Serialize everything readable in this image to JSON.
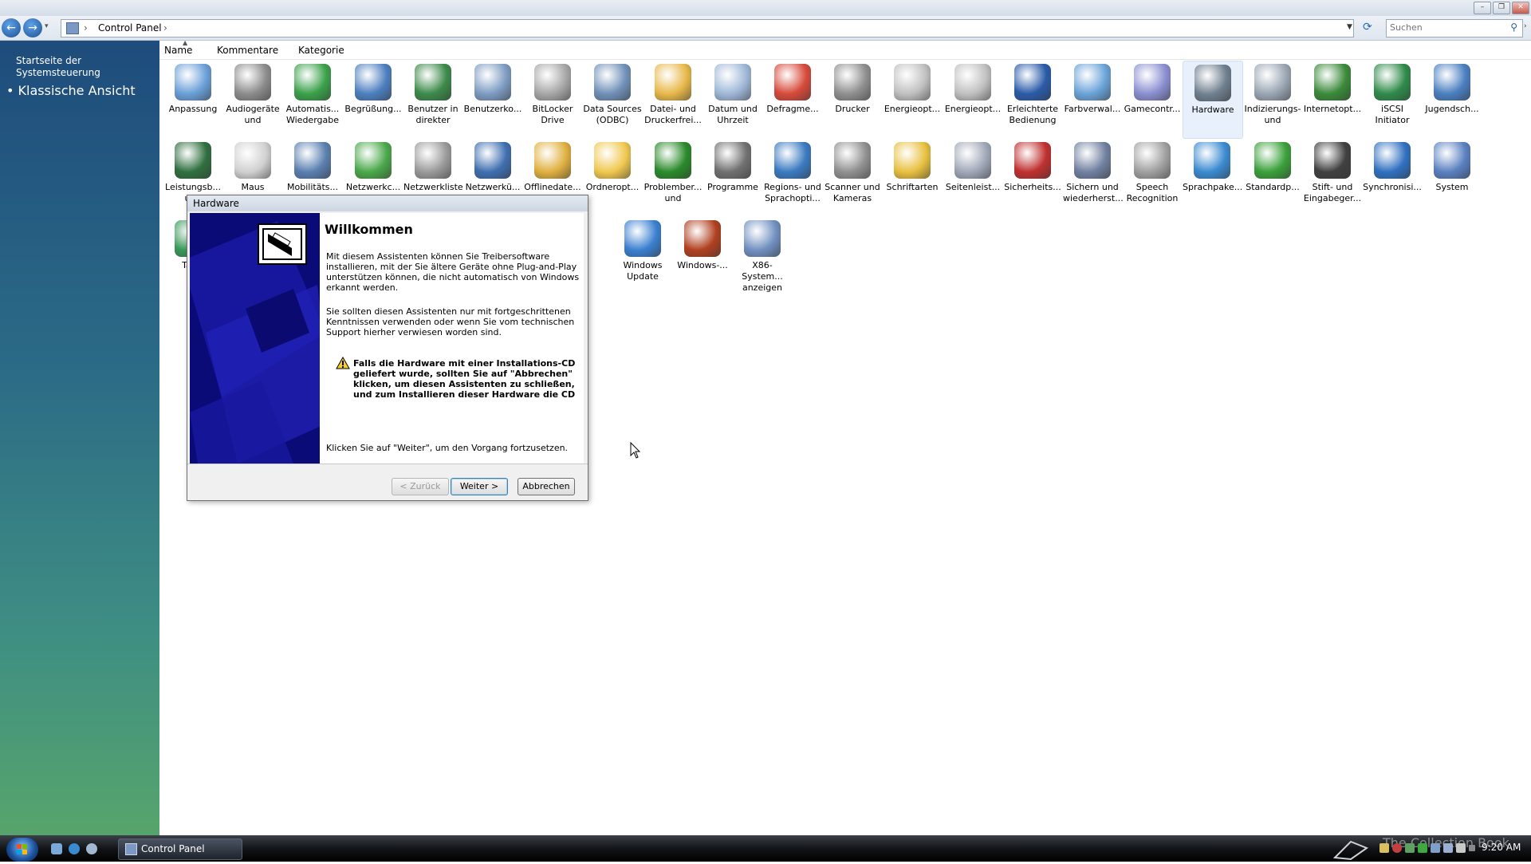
{
  "window": {
    "min_glyph": "–",
    "restore_glyph": "❐",
    "close_glyph": "✕"
  },
  "nav": {
    "back_glyph": "←",
    "forward_glyph": "→",
    "address": [
      "Control Panel"
    ],
    "search_placeholder": "Suchen"
  },
  "sidebar": {
    "home_label": "Startseite der Systemsteuerung",
    "classic_label": "Klassische Ansicht"
  },
  "columns": [
    "Name",
    "Kommentare",
    "Kategorie"
  ],
  "icons": {
    "row1": [
      {
        "label": "Anpassung",
        "icon": "personalization-icon",
        "color": "#6a9fd8"
      },
      {
        "label": "Audiogeräte und",
        "icon": "speaker-icon",
        "color": "#8c8c8c"
      },
      {
        "label": "Automatis... Wiedergabe",
        "icon": "autoplay-icon",
        "color": "#3aa14a"
      },
      {
        "label": "Begrüßung...",
        "icon": "welcome-center-icon",
        "color": "#4c7fbf"
      },
      {
        "label": "Benutzer in direkter",
        "icon": "people-near-me-icon",
        "color": "#3c8a4a"
      },
      {
        "label": "Benutzerko...",
        "icon": "user-accounts-icon",
        "color": "#7d9cc2"
      },
      {
        "label": "BitLocker Drive",
        "icon": "bitlocker-icon",
        "color": "#a7a7a7"
      },
      {
        "label": "Data Sources (ODBC)",
        "icon": "odbc-icon",
        "color": "#7090b8"
      },
      {
        "label": "Datei- und Druckerfrei...",
        "icon": "folder-share-icon",
        "color": "#e8b84a"
      },
      {
        "label": "Datum und Uhrzeit",
        "icon": "clock-icon",
        "color": "#9fb8d8"
      },
      {
        "label": "Defragme...",
        "icon": "defrag-icon",
        "color": "#d74a3a"
      },
      {
        "label": "Drucker",
        "icon": "printer-icon",
        "color": "#8f8f8f"
      },
      {
        "label": "Energieopt...",
        "icon": "power-options-icon",
        "color": "#c0c0c0"
      },
      {
        "label": "Energieopt...",
        "icon": "power-options-icon",
        "color": "#c0c0c0"
      },
      {
        "label": "Erleichterte Bedienung",
        "icon": "ease-of-access-icon",
        "color": "#2a5ba8"
      },
      {
        "label": "Farbverwal...",
        "icon": "color-management-icon",
        "color": "#6aa3d8"
      },
      {
        "label": "Gamecontr...",
        "icon": "gamepad-icon",
        "color": "#8a8fd0"
      },
      {
        "label": "Hardware",
        "icon": "hardware-icon",
        "color": "#6f7f8f"
      },
      {
        "label": "Indizierungs- und",
        "icon": "indexing-icon",
        "color": "#9aa6b3"
      },
      {
        "label": "Internetopt...",
        "icon": "internet-options-icon",
        "color": "#3a8a3a"
      },
      {
        "label": "iSCSI Initiator",
        "icon": "iscsi-icon",
        "color": "#2f8a4a"
      },
      {
        "label": "Jugendsch...",
        "icon": "parental-controls-icon",
        "color": "#4a7fc0"
      }
    ],
    "row2": [
      {
        "label": "Leistungsb... und",
        "icon": "performance-icon",
        "color": "#2f6f3f"
      },
      {
        "label": "Maus",
        "icon": "mouse-icon",
        "color": "#d0d0d0"
      },
      {
        "label": "Mobilitäts...",
        "icon": "mobility-center-icon",
        "color": "#5a7fb0"
      },
      {
        "label": "Netzwerkc...",
        "icon": "network-center-icon",
        "color": "#4aa84a"
      },
      {
        "label": "Netzwerkliste",
        "icon": "network-list-icon",
        "color": "#9a9a9a"
      },
      {
        "label": "Netzwerkü...",
        "icon": "network-map-icon",
        "color": "#3f6fb0"
      },
      {
        "label": "Offlinedate...",
        "icon": "offline-files-icon",
        "color": "#e0b040"
      },
      {
        "label": "Ordneropt...",
        "icon": "folder-options-icon",
        "color": "#f0c850"
      },
      {
        "label": "Problember... und",
        "icon": "problem-reports-icon",
        "color": "#2a8a2a"
      },
      {
        "label": "Programme",
        "icon": "programs-icon",
        "color": "#707070"
      },
      {
        "label": "Regions- und Sprachopti...",
        "icon": "regional-globe-icon",
        "color": "#3a7ac0"
      },
      {
        "label": "Scanner und Kameras",
        "icon": "camera-icon",
        "color": "#909090"
      },
      {
        "label": "Schriftarten",
        "icon": "fonts-folder-icon",
        "color": "#e8c040"
      },
      {
        "label": "Seitenleist...",
        "icon": "sidebar-gear-icon",
        "color": "#a0a8b8"
      },
      {
        "label": "Sicherheits...",
        "icon": "security-shield-icon",
        "color": "#c03030"
      },
      {
        "label": "Sichern und wiederherst...",
        "icon": "backup-icon",
        "color": "#7080a0"
      },
      {
        "label": "Speech Recognition",
        "icon": "microphone-icon",
        "color": "#a0a0a0"
      },
      {
        "label": "Sprachpake...",
        "icon": "language-pack-icon",
        "color": "#3a8ad0"
      },
      {
        "label": "Standardp...",
        "icon": "default-programs-icon",
        "color": "#3aa03a"
      },
      {
        "label": "Stift- und Eingabeger...",
        "icon": "pen-icon",
        "color": "#404040"
      },
      {
        "label": "Synchronisi...",
        "icon": "sync-icon",
        "color": "#3070c0"
      },
      {
        "label": "System",
        "icon": "system-icon",
        "color": "#5a80c0"
      }
    ],
    "row3": [
      {
        "label": "Tas...",
        "icon": "taskbar-icon",
        "color": "#3a9a5a"
      },
      {
        "label": "Windows Update",
        "icon": "windows-update-icon",
        "color": "#3a80d0"
      },
      {
        "label": "Windows-...",
        "icon": "firewall-icon",
        "color": "#b04020"
      },
      {
        "label": "X86-System... anzeigen",
        "icon": "x86-system-icon",
        "color": "#7090c0"
      }
    ]
  },
  "dialog": {
    "title": "Hardware",
    "heading": "Willkommen",
    "para1": [
      "Mit diesem Assistenten können Sie Treibersoftware",
      "installieren, mit der Sie ältere Geräte ohne Plug-and-Play",
      "unterstützen können, die nicht automatisch von Windows",
      "erkannt werden."
    ],
    "para2": [
      "Sie sollten diesen Assistenten nur mit fortgeschrittenen",
      "Kenntnissen verwenden oder wenn Sie vom technischen",
      "Support hierher verwiesen worden sind."
    ],
    "warning": [
      "Falls die Hardware mit einer Installations-CD",
      "geliefert wurde, sollten Sie auf \"Abbrechen\"",
      "klicken, um diesen Assistenten zu schließen,",
      "und zum Installieren dieser Hardware die CD"
    ],
    "footer_text": "Klicken Sie auf \"Weiter\", um den Vorgang fortzusetzen.",
    "buttons": {
      "back": "< Zurück",
      "next": "Weiter >",
      "cancel": "Abbrechen"
    }
  },
  "taskbar": {
    "window_button": "Control Panel",
    "watermark": "The Collection Book",
    "clock": "9:20 AM"
  },
  "colors": {
    "sidebar_top": "#1e4c7c",
    "sidebar_bottom": "#57a56b",
    "dialog_side": "#0b0b78",
    "taskbar": "#121418"
  }
}
